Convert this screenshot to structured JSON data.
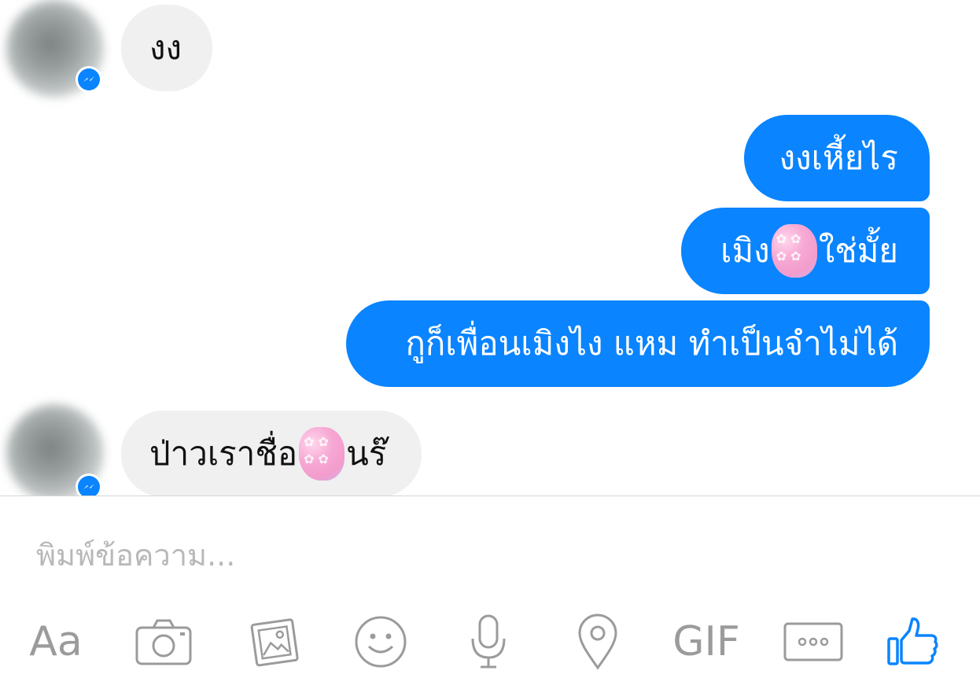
{
  "messages": [
    {
      "side": "incoming",
      "text": "งง"
    },
    {
      "side": "outgoing",
      "text": "งงเหี้ยไร"
    },
    {
      "side": "outgoing",
      "before": "เมิง",
      "after": "ใช่มั้ย"
    },
    {
      "side": "outgoing",
      "text": "กูก็เพื่อนเมิงไง แหม ทำเป็นจำไม่ได้"
    },
    {
      "side": "incoming",
      "before": "ป่าวเราชื่อ",
      "after": "นร๊"
    }
  ],
  "composer": {
    "placeholder": "พิมพ์ข้อความ..."
  },
  "toolbar": {
    "aa_label": "Aa",
    "gif_label": "GIF",
    "icons": [
      "camera-icon",
      "photo-icon",
      "emoji-icon",
      "microphone-icon",
      "location-icon",
      "more-icon",
      "like-icon"
    ]
  },
  "colors": {
    "outgoing_bubble": "#0a84ff",
    "incoming_bubble": "#f0f0f0",
    "toolbar_icon": "#9b9b9b",
    "like_icon": "#0a84ff"
  }
}
